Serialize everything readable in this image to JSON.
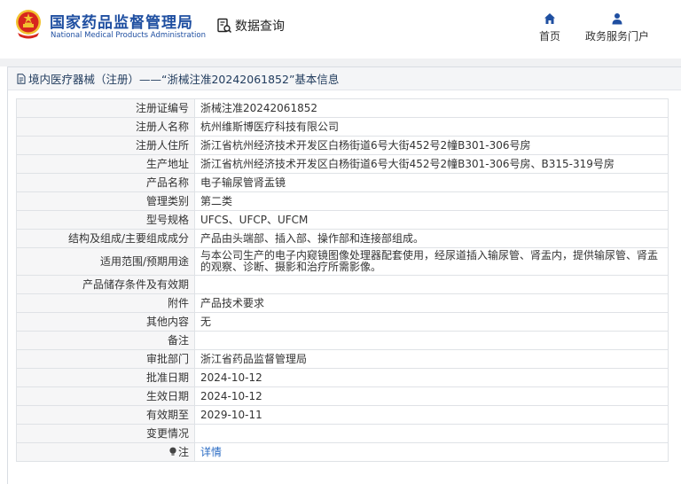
{
  "header": {
    "title_cn": "国家药品监督管理局",
    "title_en": "National Medical Products Administration",
    "data_query_label": "数据查询",
    "nav": {
      "home_label": "首页",
      "portal_label": "政务服务门户"
    }
  },
  "panel": {
    "heading": "境内医疗器械（注册）——“浙械注准20242061852”基本信息"
  },
  "rows": [
    {
      "key": "注册证编号",
      "value": "浙械注准20242061852"
    },
    {
      "key": "注册人名称",
      "value": "杭州维斯博医疗科技有限公司"
    },
    {
      "key": "注册人住所",
      "value": "浙江省杭州经济技术开发区白杨街道6号大街452号2幢B301-306号房"
    },
    {
      "key": "生产地址",
      "value": "浙江省杭州经济技术开发区白杨街道6号大街452号2幢B301-306号房、B315-319号房"
    },
    {
      "key": "产品名称",
      "value": "电子输尿管肾盂镜"
    },
    {
      "key": "管理类别",
      "value": "第二类"
    },
    {
      "key": "型号规格",
      "value": "UFCS、UFCP、UFCM"
    },
    {
      "key": "结构及组成/主要组成成分",
      "value": "产品由头端部、插入部、操作部和连接部组成。"
    },
    {
      "key": "适用范围/预期用途",
      "value": "与本公司生产的电子内窥镜图像处理器配套使用，经尿道插入输尿管、肾盂内，提供输尿管、肾盂的观察、诊断、摄影和治疗所需影像。"
    },
    {
      "key": "产品储存条件及有效期",
      "value": ""
    },
    {
      "key": "附件",
      "value": "产品技术要求"
    },
    {
      "key": "其他内容",
      "value": "无"
    },
    {
      "key": "备注",
      "value": ""
    },
    {
      "key": "审批部门",
      "value": "浙江省药品监督管理局"
    },
    {
      "key": "批准日期",
      "value": "2024-10-12"
    },
    {
      "key": "生效日期",
      "value": "2024-10-12"
    },
    {
      "key": "有效期至",
      "value": "2029-10-11"
    },
    {
      "key": "变更情况",
      "value": ""
    },
    {
      "key": "注",
      "value": "详情"
    }
  ],
  "colors": {
    "brand_blue": "#1f4fa1",
    "emblem_red": "#d7261e",
    "emblem_gold": "#f2c230",
    "link": "#2b6cc4"
  },
  "icons": {
    "emblem": "national-emblem-icon",
    "query": "document-search-icon",
    "home": "home-icon",
    "portal": "user-icon",
    "heading": "document-icon",
    "note": "lightbulb-icon"
  }
}
